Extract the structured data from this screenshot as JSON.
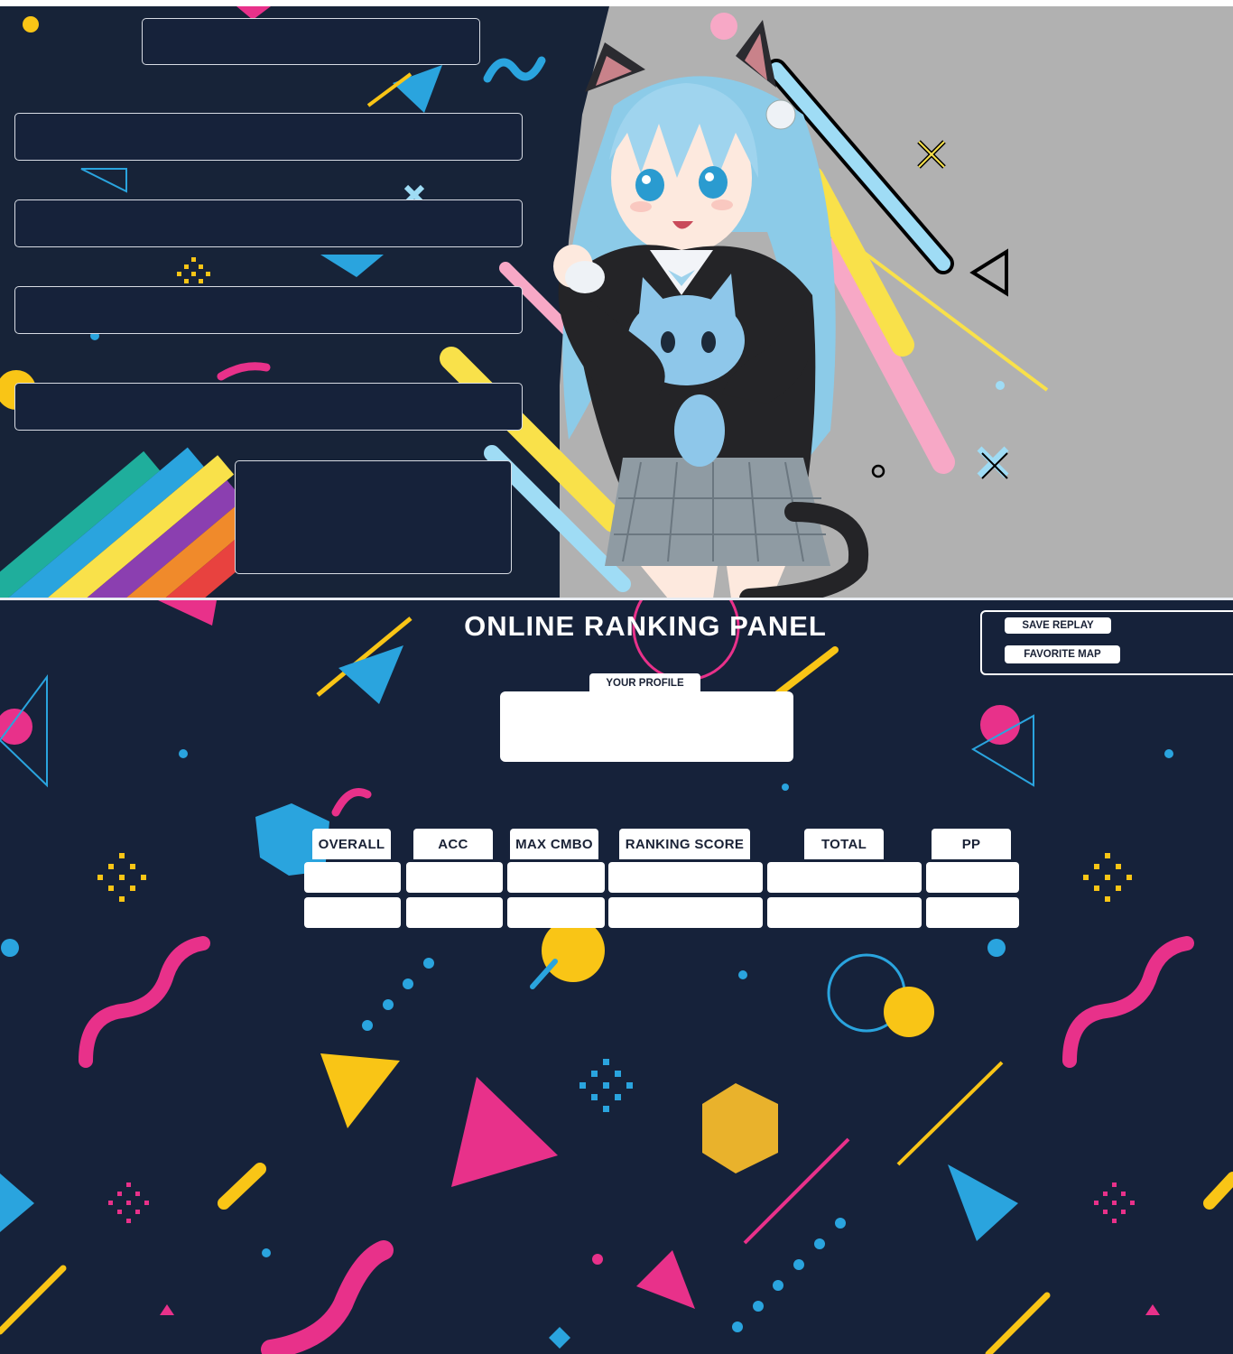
{
  "panel": {
    "title": "ONLINE RANKING PANEL"
  },
  "profile": {
    "tab_label": "YOUR PROFILE"
  },
  "actions": {
    "save_replay": "SAVE REPLAY",
    "favorite_map": "FAVORITE MAP"
  },
  "table": {
    "headers": [
      "OVERALL",
      "ACC",
      "MAX CMBO",
      "RANKING SCORE",
      "TOTAL",
      "PP"
    ]
  },
  "colors": {
    "background": "#16223a",
    "accent_pink": "#e8318a",
    "accent_yellow": "#f9c516",
    "accent_blue": "#2aa4de",
    "panel_gray": "#b1b1b1"
  },
  "icons": [
    "cat-girl-illustration",
    "memphis-shapes-decoration"
  ]
}
